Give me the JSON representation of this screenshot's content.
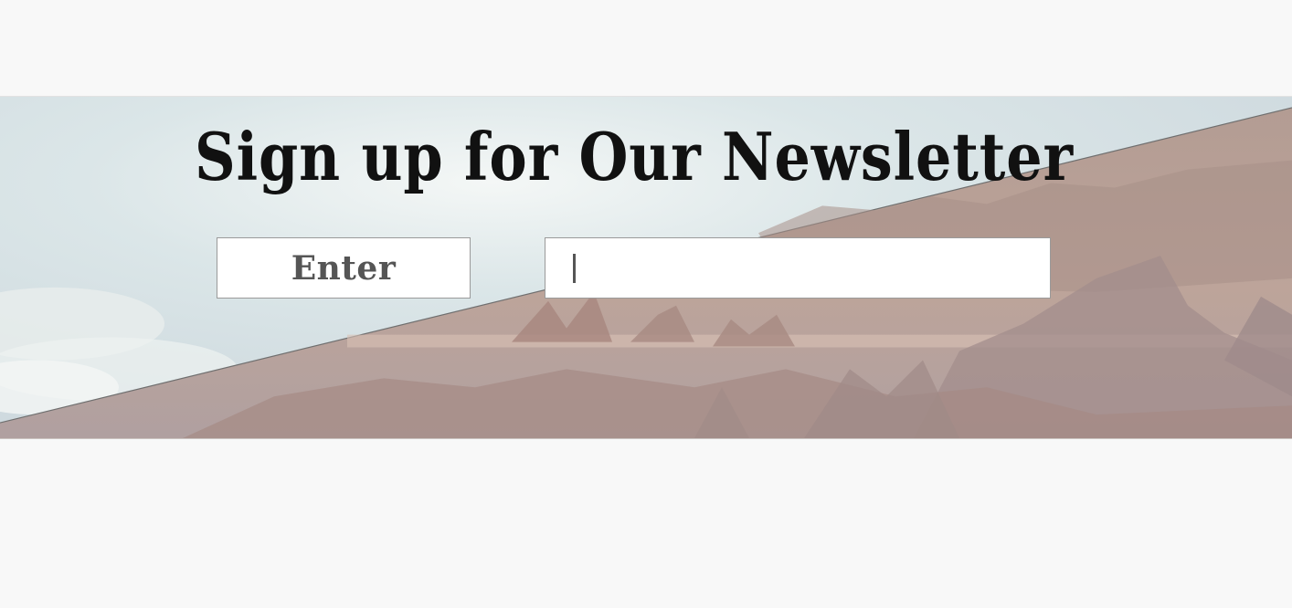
{
  "newsletter": {
    "title": "Sign up for Our Newsletter",
    "enter_label": "Enter",
    "email_value": "",
    "email_placeholder": ""
  },
  "colors": {
    "page_background": "#f8f8f8",
    "sky": "#dfe8ea",
    "desert": "#b59c92",
    "title_text": "#111111",
    "button_text": "#555555"
  }
}
